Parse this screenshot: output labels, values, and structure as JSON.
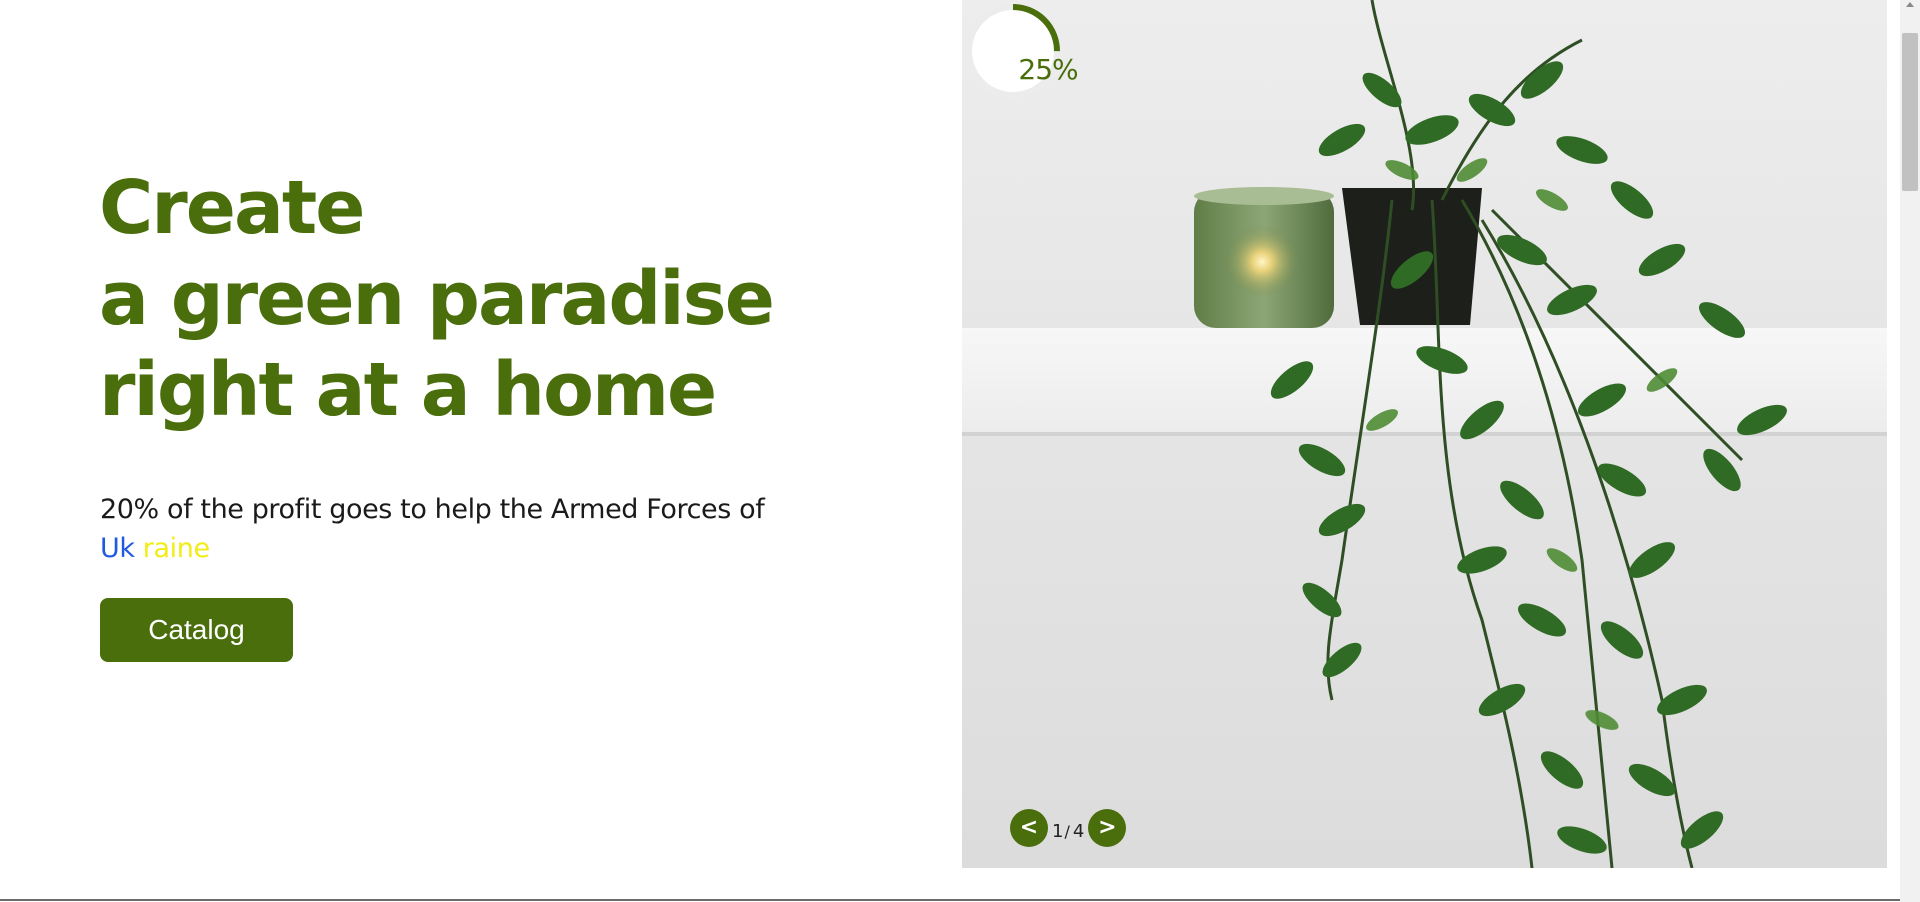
{
  "hero": {
    "title_lines": [
      "Create",
      "a green paradise",
      "right at a home"
    ],
    "subtitle": "20% of the profit goes to help the Armed Forces of",
    "ukraine_part1": "Uk",
    "ukraine_part2": "raine",
    "catalog_label": "Catalog"
  },
  "slider": {
    "progress_text": "25%",
    "progress_value": 0.25,
    "prev_label": "<",
    "next_label": ">",
    "current": "1",
    "separator": "/",
    "total": "4"
  },
  "colors": {
    "brand_green": "#4a6e0b",
    "ukraine_blue": "#1f5ae0",
    "ukraine_yellow": "#f2ec18"
  }
}
